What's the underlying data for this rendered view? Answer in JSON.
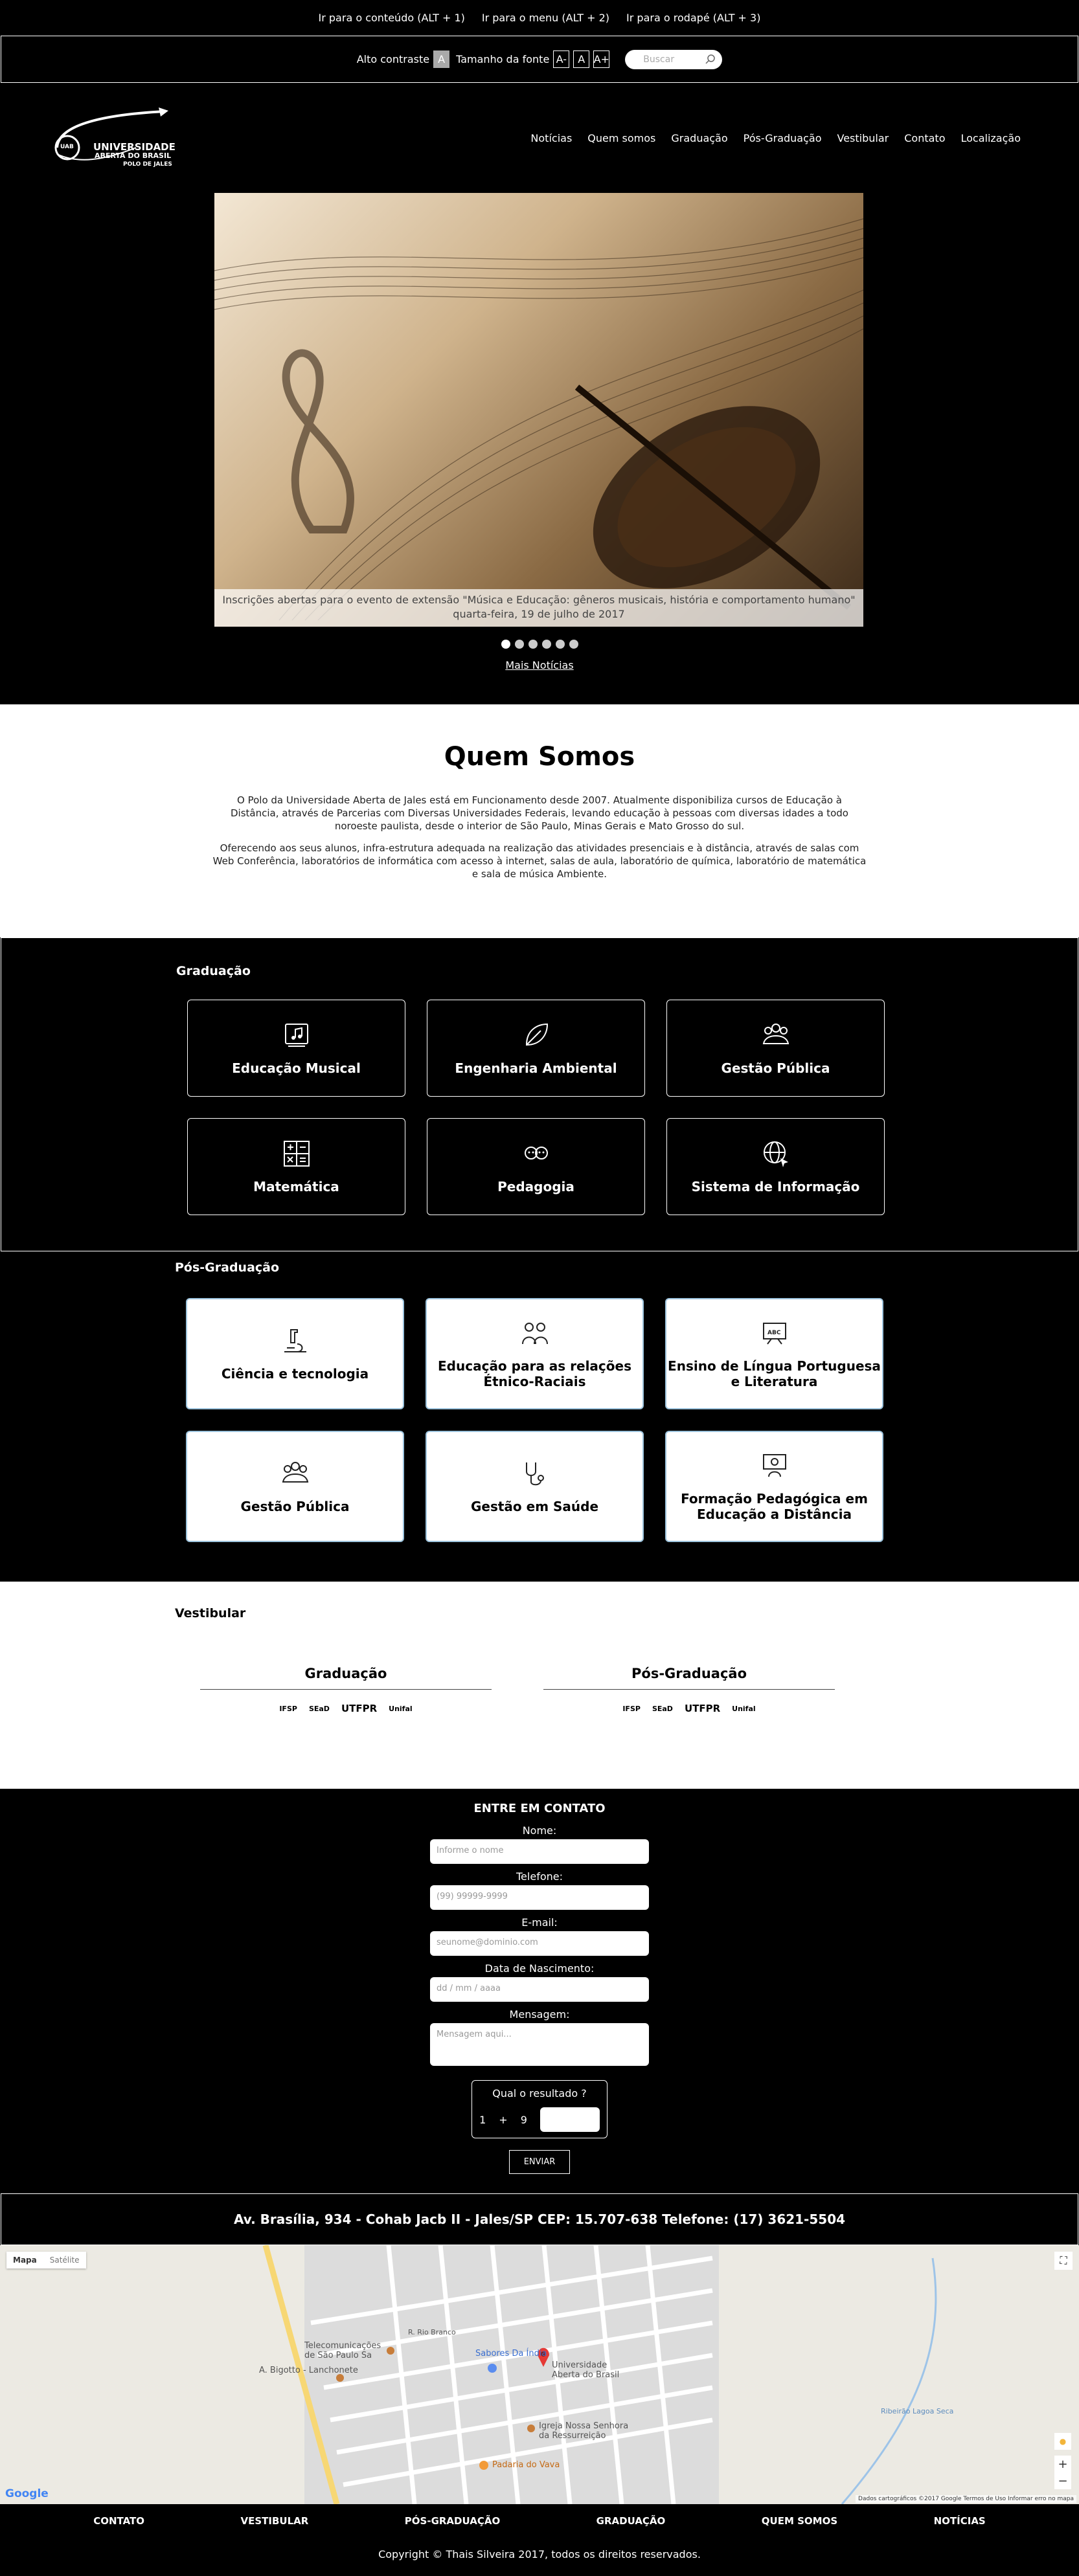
{
  "skip_links": [
    "Ir para o conteúdo (ALT + 1)",
    "Ir para o menu (ALT + 2)",
    "Ir para o rodapé (ALT + 3)"
  ],
  "accessibility": {
    "high_contrast": "Alto contraste",
    "high_contrast_btn": "A",
    "font_size": "Tamanho da fonte",
    "font_minus": "A-",
    "font_normal": "A",
    "font_plus": "A+",
    "search_placeholder": "Buscar"
  },
  "logo": {
    "abbr": "UAB",
    "name": "UNIVERSIDADE",
    "name2": "ABERTA DO BRASIL",
    "sub": "POLO DE JALES"
  },
  "nav": [
    "Notícias",
    "Quem somos",
    "Graduação",
    "Pós-Graduação",
    "Vestibular",
    "Contato",
    "Localização"
  ],
  "slider": {
    "caption": "Inscrições abertas para o evento de extensão \"Música e Educação: gêneros musicais, história e comportamento humano\"",
    "date": "quarta-feira, 19 de julho de 2017",
    "slide_count": 6,
    "active_index": 0,
    "more_news": "Mais Notícias"
  },
  "about": {
    "title": "Quem Somos",
    "p1": "O Polo da Universidade Aberta de Jales está em Funcionamento desde 2007. Atualmente disponibiliza cursos de Educação à Distância, através de Parcerias com Diversas Universidades Federais, levando educação à pessoas com diversas idades a todo noroeste paulista, desde o interior de São Paulo, Minas Gerais e Mato Grosso do sul.",
    "p2": "Oferecendo aos seus alunos, infra-estrutura adequada na realização das atividades presenciais e à distância, através de salas com Web Conferência, laboratórios de informática com acesso à internet, salas de aula, laboratório de química, laboratório de matemática e sala de música Ambiente."
  },
  "graduacao": {
    "title": "Graduação",
    "courses": [
      {
        "label": "Educação Musical",
        "icon": "music-book-icon"
      },
      {
        "label": "Engenharia Ambiental",
        "icon": "leaf-icon"
      },
      {
        "label": "Gestão Pública",
        "icon": "people-icon"
      },
      {
        "label": "Matemática",
        "icon": "calculator-icon"
      },
      {
        "label": "Pedagogia",
        "icon": "children-icon"
      },
      {
        "label": "Sistema de Informação",
        "icon": "globe-cursor-icon"
      }
    ]
  },
  "pos": {
    "title": "Pós-Graduação",
    "courses": [
      {
        "label": "Ciência e tecnologia",
        "icon": "microscope-icon"
      },
      {
        "label": "Educação para as relações Étnico-Raciais",
        "icon": "diverse-people-icon"
      },
      {
        "label": "Ensino de Língua Portuguesa e Literatura",
        "icon": "blackboard-icon"
      },
      {
        "label": "Gestão Pública",
        "icon": "people-icon"
      },
      {
        "label": "Gestão em Saúde",
        "icon": "stethoscope-icon"
      },
      {
        "label": "Formação Pedagógica em Educação a Distância",
        "icon": "teacher-screen-icon"
      }
    ]
  },
  "vestibular": {
    "title": "Vestibular",
    "graduacao": "Graduação",
    "pos": "Pós-Graduação",
    "partners": [
      "IFSP",
      "SEaD",
      "UTFPR",
      "Unifal"
    ]
  },
  "contact": {
    "title": "ENTRE EM CONTATO",
    "fields": [
      {
        "label": "Nome:",
        "placeholder": "Informe o nome"
      },
      {
        "label": "Telefone:",
        "placeholder": "(99) 99999-9999"
      },
      {
        "label": "E-mail:",
        "placeholder": "seunome@dominio.com"
      },
      {
        "label": "Data de Nascimento:",
        "placeholder": "dd / mm / aaaa"
      },
      {
        "label": "Mensagem:",
        "placeholder": "Mensagem aqui..."
      }
    ],
    "captcha_title": "Qual o resultado ?",
    "captcha_a": "1",
    "captcha_op": "+",
    "captcha_b": "9",
    "send": "ENVIAR"
  },
  "address": "Av. Brasília, 934 - Cohab Jacb II - Jales/SP CEP: 15.707-638 Telefone: (17) 3621-5504",
  "map": {
    "tab_map": "Mapa",
    "tab_sat": "Satélite",
    "labels": [
      "Telecomunicações de São Paulo Sa",
      "A. Bigotto - Lanchonete",
      "Sabores Da Índia",
      "Universidade Aberta do Brasil",
      "Igreja Nossa Senhora da Ressurreição",
      "Padaria do Vava",
      "R. Rio Branco",
      "Ribeirão Lagoa Seca"
    ],
    "attribution": "Dados cartográficos ©2017 Google   Termos de Uso   Informar erro no mapa",
    "google": "Google"
  },
  "footer_nav": [
    "CONTATO",
    "VESTIBULAR",
    "PÓS-GRADUAÇÃO",
    "GRADUAÇÃO",
    "QUEM SOMOS",
    "NOTÍCIAS"
  ],
  "copyright": "Copyright © Thais Silveira 2017, todos os direitos reservados."
}
